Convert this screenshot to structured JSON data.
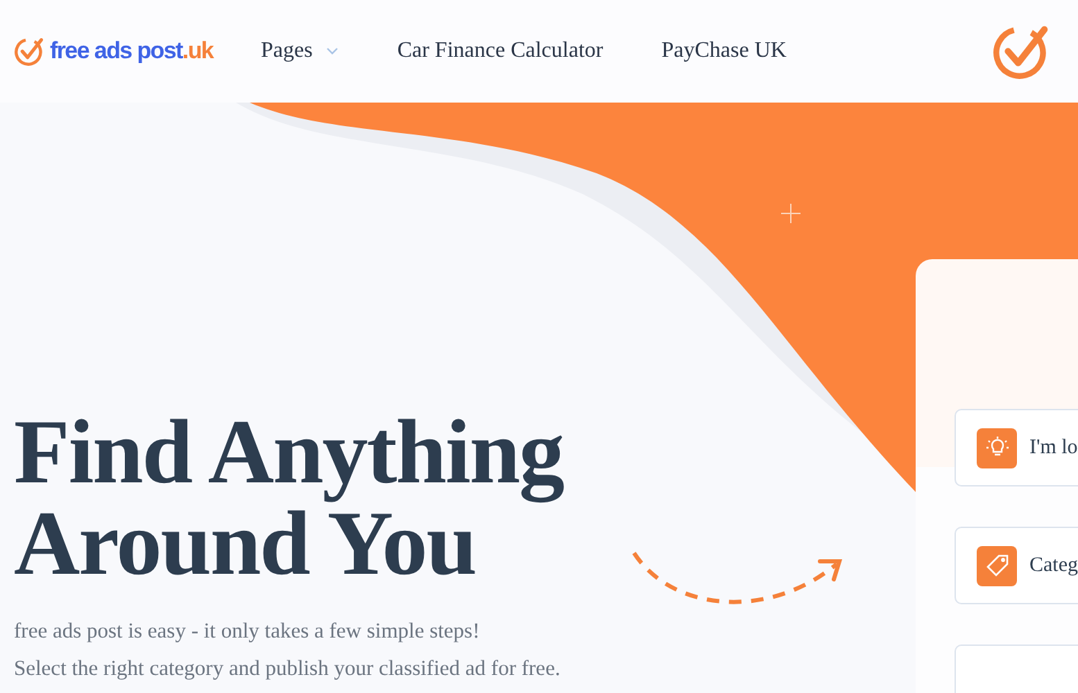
{
  "header": {
    "logo": {
      "name": "free ads post",
      "tld": ".uk"
    },
    "nav": [
      {
        "label": "Pages",
        "has_menu": true
      },
      {
        "label": "Car Finance Calculator",
        "has_menu": false
      },
      {
        "label": "PayChase UK",
        "has_menu": false
      }
    ]
  },
  "hero": {
    "title_lines": [
      "Find Anything",
      "Around You"
    ],
    "paragraphs": [
      "free ads post is easy - it only takes a few simple steps!",
      "Select the right category and publish your classified ad for free."
    ]
  },
  "search_card": {
    "fields": [
      {
        "kind": "idea",
        "text": "I'm lo"
      },
      {
        "kind": "tag",
        "text": "Categ"
      },
      {
        "kind": "blank"
      }
    ]
  }
}
